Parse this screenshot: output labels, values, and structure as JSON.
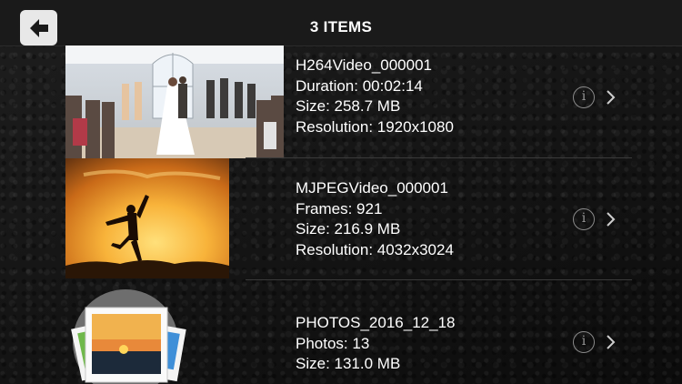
{
  "header": {
    "title": "3 ITEMS",
    "back_icon": "arrow-left-icon"
  },
  "items": [
    {
      "name": "H264Video_000001",
      "line2": "Duration: 00:02:14",
      "line3": "Size: 258.7 MB",
      "line4": "Resolution: 1920x1080",
      "thumbnail": "wedding-ceremony-photo",
      "info_label": "i"
    },
    {
      "name": "MJPEGVideo_000001",
      "line2": "Frames: 921",
      "line3": "Size: 216.9 MB",
      "line4": "Resolution: 4032x3024",
      "thumbnail": "sunset-jump-silhouette-photo",
      "info_label": "i"
    },
    {
      "name": "PHOTOS_2016_12_18",
      "line2": "Photos: 13",
      "line3": "Size: 131.0 MB",
      "thumbnail": "photo-stack-icon",
      "info_label": "i"
    }
  ],
  "colors": {
    "accent": "#ffffff",
    "divider": "#3a3a3a",
    "back_button_bg": "#e8e8e8"
  }
}
